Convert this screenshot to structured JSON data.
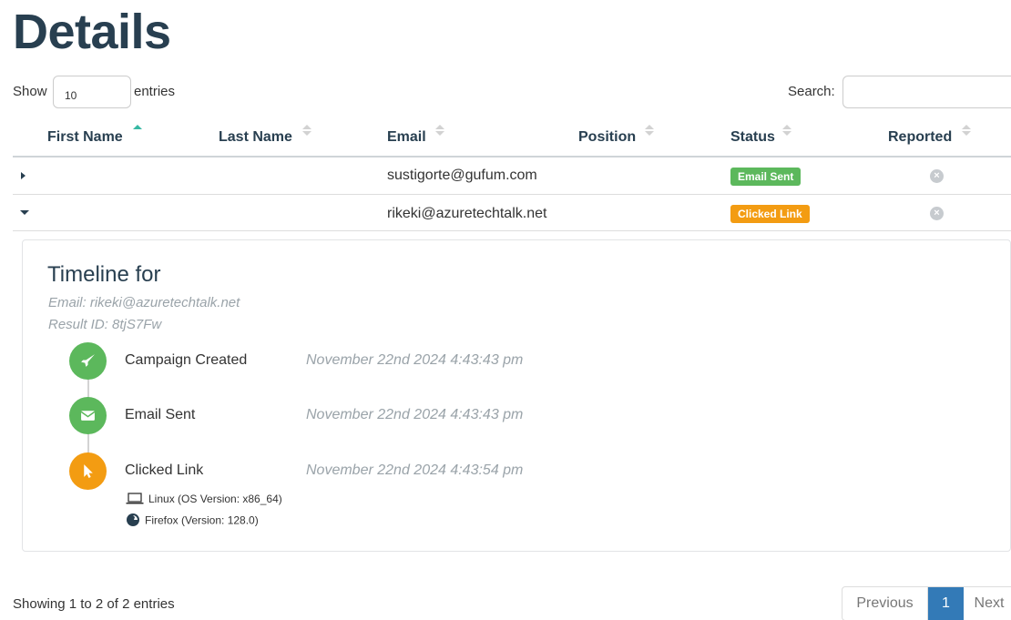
{
  "page": {
    "title": "Details"
  },
  "controls": {
    "show_label": "Show",
    "entries_value": "10",
    "entries_label": "entries",
    "search_label": "Search:",
    "search_value": ""
  },
  "table": {
    "columns": [
      "First Name",
      "Last Name",
      "Email",
      "Position",
      "Status",
      "Reported"
    ],
    "sorted_column": "First Name",
    "rows": [
      {
        "first_name": "",
        "last_name": "",
        "email": "sustigorte@gufum.com",
        "position": "",
        "status": "Email Sent",
        "status_color": "#5cb85c",
        "reported_icon": "x-circle-icon",
        "expanded": false
      },
      {
        "first_name": "",
        "last_name": "",
        "email": "rikeki@azuretechtalk.net",
        "position": "",
        "status": "Clicked Link",
        "status_color": "#f39c12",
        "reported_icon": "x-circle-icon",
        "expanded": true
      }
    ]
  },
  "timeline": {
    "title": "Timeline for",
    "email_line": "Email: rikeki@azuretechtalk.net",
    "result_line": "Result ID: 8tjS7Fw",
    "events": [
      {
        "label": "Campaign Created",
        "time": "November 22nd 2024 4:43:43 pm",
        "icon": "rocket-icon",
        "color": "#5cb85c"
      },
      {
        "label": "Email Sent",
        "time": "November 22nd 2024 4:43:43 pm",
        "icon": "envelope-icon",
        "color": "#5cb85c"
      },
      {
        "label": "Clicked Link",
        "time": "November 22nd 2024 4:43:54 pm",
        "icon": "cursor-icon",
        "color": "#f39c12"
      }
    ],
    "details": {
      "os": "Linux (OS Version: x86_64)",
      "browser": "Firefox (Version: 128.0)"
    }
  },
  "footer": {
    "info": "Showing 1 to 2 of 2 entries",
    "prev": "Previous",
    "page": "1",
    "next": "Next"
  }
}
